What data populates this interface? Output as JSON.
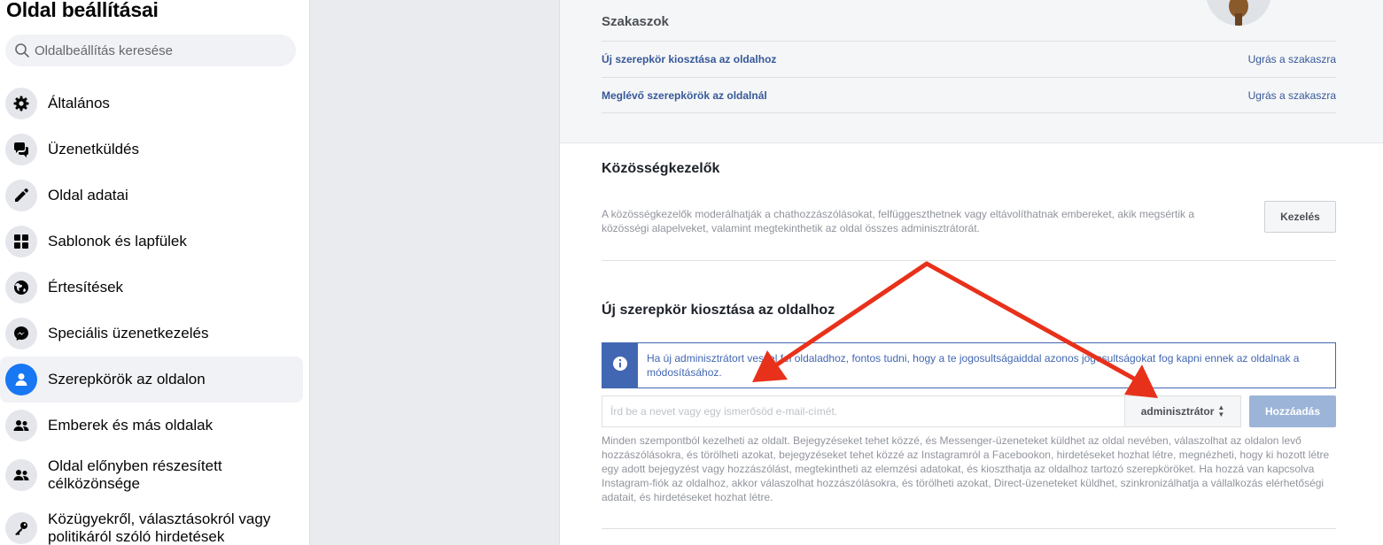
{
  "sidebar": {
    "title": "Oldal beállításai",
    "search_placeholder": "Oldalbeállítás keresése",
    "items": [
      {
        "label": "Általános",
        "icon": "gear-icon"
      },
      {
        "label": "Üzenetküldés",
        "icon": "chat-bubbles-icon"
      },
      {
        "label": "Oldal adatai",
        "icon": "pencil-icon"
      },
      {
        "label": "Sablonok és lapfülek",
        "icon": "grid-icon"
      },
      {
        "label": "Értesítések",
        "icon": "globe-icon"
      },
      {
        "label": "Speciális üzenetkezelés",
        "icon": "messenger-icon"
      },
      {
        "label": "Szerepkörök az oldalon",
        "icon": "person-icon",
        "active": true
      },
      {
        "label": "Emberek és más oldalak",
        "icon": "people-icon"
      },
      {
        "label": "Oldal előnyben részesített célközönsége",
        "icon": "people-icon"
      },
      {
        "label": "Közügyekről, választásokról vagy politikáról szóló hirdetések",
        "icon": "key-icon"
      }
    ]
  },
  "sections": {
    "title": "Szakaszok",
    "rows": [
      {
        "label": "Új szerepkör kiosztása az oldalhoz",
        "jump": "Ugrás a szakaszra"
      },
      {
        "label": "Meglévő szerepkörök az oldalnál",
        "jump": "Ugrás a szakaszra"
      }
    ]
  },
  "community": {
    "heading": "Közösségkezelők",
    "text": "A közösségkezelők moderálhatják a chathozzászólásokat, felfüggeszthetnek vagy eltávolíthatnak embereket, akik megsértik a közösségi alapelveket, valamint megtekinthetik az oldal összes adminisztrátorát.",
    "button": "Kezelés"
  },
  "new_role": {
    "heading": "Új szerepkör kiosztása az oldalhoz",
    "info": "Ha új adminisztrátort veszel fel oldaladhoz, fontos tudni, hogy a te jogosultságaiddal azonos jogosultságokat fog kapni ennek az oldalnak a módosításához.",
    "input_placeholder": "Írd be a nevet vagy egy ismerősöd e-mail-címét.",
    "role_selected": "adminisztrátor",
    "add_button": "Hozzáadás",
    "description": "Minden szempontból kezelheti az oldalt. Bejegyzéseket tehet közzé, és Messenger-üzeneteket küldhet az oldal nevében, válaszolhat az oldalon levő hozzászólásokra, és törölheti azokat, bejegyzéseket tehet közzé az Instagramról a Facebookon, hirdetéseket hozhat létre, megnézheti, hogy ki hozott létre egy adott bejegyzést vagy hozzászólást, megtekintheti az elemzési adatokat, és kioszthatja az oldalhoz tartozó szerepköröket. Ha hozzá van kapcsolva Instagram-fiók az oldalhoz, akkor válaszolhat hozzászólásokra, és törölheti azokat, Direct-üzeneteket küldhet, szinkronizálhatja a vállalkozás elérhetőségi adatait, és hirdetéseket hozhat létre."
  },
  "colors": {
    "link": "#365899",
    "accent": "#4267b2",
    "active_icon": "#1877f2",
    "annotation_arrow": "#e8311a"
  }
}
